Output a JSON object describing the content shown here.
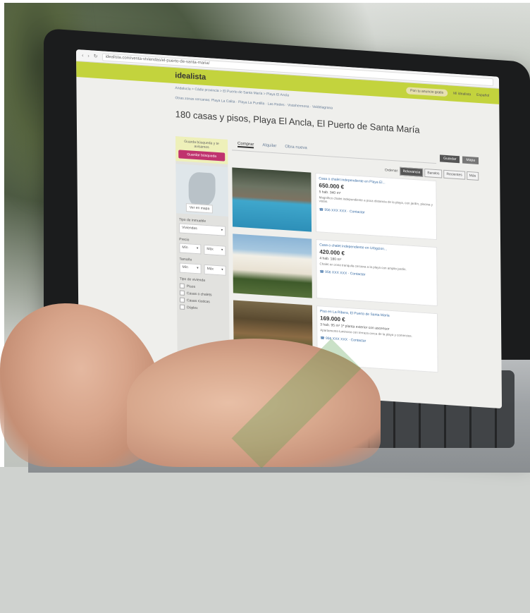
{
  "site": {
    "logo": "idealista",
    "url": "idealista.com/venta-viviendas/el-puerto-de-santa-maria/",
    "header_pill": "Pon tu anuncio gratis",
    "header_link_1": "Mi idealista",
    "header_link_2": "Español"
  },
  "breadcrumb": "Andalucía > Cádiz provincia > El Puerto de Santa María > Playa El Ancla",
  "zones": "Otras zonas cercanas: Playa La Calita · Playa La Puntilla · Las Redes · Vistahermosa · Valdelagrana",
  "page_title": "180 casas y pisos, Playa El Ancla, El Puerto de Santa María",
  "left_panel": {
    "save_label": "Guarda búsqueda y te avisamos",
    "save_button": "Guardar búsqueda",
    "map_button": "Ver en mapa",
    "type_label": "Tipo de inmueble",
    "type_value": "Viviendas",
    "price_label": "Precio",
    "price_min": "Mín",
    "price_max": "Máx",
    "size_label": "Tamaño",
    "size_min": "Mín",
    "size_max": "Máx",
    "kind_label": "Tipo de vivienda",
    "kinds": [
      "Pisos",
      "Casas o chalets",
      "Casas rústicas",
      "Dúplex"
    ]
  },
  "tabs": {
    "items": [
      "Comprar",
      "Alquilar",
      "Obra nueva"
    ],
    "btn_saved": "Guardar",
    "btn_map": "Mapa"
  },
  "order": {
    "label": "Ordenar:",
    "options": [
      "Relevancia",
      "Baratos",
      "Recientes",
      "Más"
    ]
  },
  "listings": [
    {
      "title": "Casa o chalet independiente en Playa El...",
      "price": "650.000 €",
      "meta": "5 hab. 340 m²",
      "desc": "Magnífico chalet independiente a poca distancia de la playa, con jardín, piscina y vistas.",
      "phone": "956 XXX XXX",
      "contact": "Contactar"
    },
    {
      "title": "Casa o chalet independiente en Urbgcion...",
      "price": "420.000 €",
      "meta": "4 hab. 180 m²",
      "desc": "Chalet en zona tranquila cercana a la playa con amplio jardín.",
      "phone": "956 XXX XXX",
      "contact": "Contactar"
    },
    {
      "title": "Piso en La Ribera, El Puerto de Santa María",
      "price": "169.000 €",
      "meta": "3 hab. 95 m² 1ª planta exterior con ascensor",
      "desc": "Apartamento luminoso con terraza cerca de la playa y comercios.",
      "phone": "956 XXX XXX",
      "contact": "Contactar"
    }
  ]
}
